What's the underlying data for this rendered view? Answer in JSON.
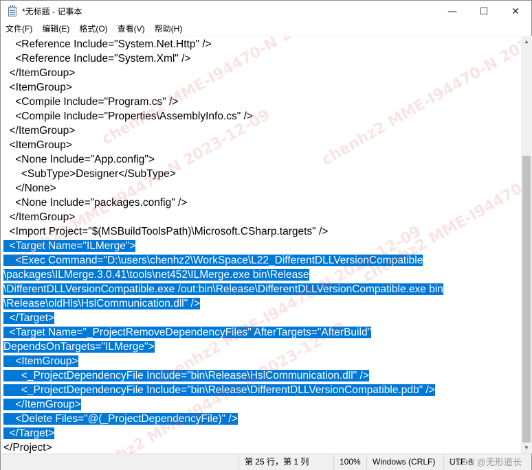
{
  "window": {
    "title": "*无标题 - 记事本",
    "controls": {
      "minimize": "—",
      "maximize": "☐",
      "close": "✕"
    },
    "icon": "notepad-icon"
  },
  "menu": [
    "文件(F)",
    "编辑(E)",
    "格式(O)",
    "查看(V)",
    "帮助(H)"
  ],
  "editor": {
    "lines": [
      {
        "text": "    <Reference Include=\"System.Net.Http\" />",
        "selected": false
      },
      {
        "text": "    <Reference Include=\"System.Xml\" />",
        "selected": false
      },
      {
        "text": "  </ItemGroup>",
        "selected": false
      },
      {
        "text": "  <ItemGroup>",
        "selected": false
      },
      {
        "text": "    <Compile Include=\"Program.cs\" />",
        "selected": false
      },
      {
        "text": "    <Compile Include=\"Properties\\AssemblyInfo.cs\" />",
        "selected": false
      },
      {
        "text": "  </ItemGroup>",
        "selected": false
      },
      {
        "text": "  <ItemGroup>",
        "selected": false
      },
      {
        "text": "    <None Include=\"App.config\">",
        "selected": false
      },
      {
        "text": "      <SubType>Designer</SubType>",
        "selected": false
      },
      {
        "text": "    </None>",
        "selected": false
      },
      {
        "text": "    <None Include=\"packages.config\" />",
        "selected": false
      },
      {
        "text": "  </ItemGroup>",
        "selected": false
      },
      {
        "text": "  <Import Project=\"$(MSBuildToolsPath)\\Microsoft.CSharp.targets\" />",
        "selected": false
      },
      {
        "text": "  <Target Name=\"ILMerge\">",
        "selected": true
      },
      {
        "text": "    <Exec Command=\"D:\\users\\chenhz2\\WorkSpace\\L22_DifferentDLLVersionCompatible",
        "selected": true
      },
      {
        "text": "\\packages\\ILMerge.3.0.41\\tools\\net452\\ILMerge.exe bin\\Release",
        "selected": true
      },
      {
        "text": "\\DifferentDLLVersionCompatible.exe /out:bin\\Release\\DifferentDLLVersionCompatible.exe bin",
        "selected": true
      },
      {
        "text": "\\Release\\oldHls\\HslCommunication.dll\" />",
        "selected": true
      },
      {
        "text": "  </Target>",
        "selected": true
      },
      {
        "text": "  <Target Name=\"_ProjectRemoveDependencyFiles\" AfterTargets=\"AfterBuild\"",
        "selected": true
      },
      {
        "text": "DependsOnTargets=\"ILMerge\">",
        "selected": true
      },
      {
        "text": "    <ItemGroup>",
        "selected": true
      },
      {
        "text": "      <_ProjectDependencyFile Include=\"bin\\Release\\HslCommunication.dll\" />",
        "selected": true
      },
      {
        "text": "      <_ProjectDependencyFile Include=\"bin\\Release\\DifferentDLLVersionCompatible.pdb\" />",
        "selected": true
      },
      {
        "text": "    </ItemGroup>",
        "selected": true
      },
      {
        "text": "    <Delete Files=\"@(_ProjectDependencyFile)\" />",
        "selected": true
      },
      {
        "text": "  </Target>",
        "selected": true
      },
      {
        "text": "</Project>",
        "selected": false
      }
    ]
  },
  "watermark": [
    "chenhz2 MME-I94470-N 2023-12-09",
    "chenhz2 MME-I94470-N 2023-12-09",
    "chenhz2 MME-I94470-N 2023-12-09",
    "chenhz2 MME-I94470-N 2023-12-09",
    "chenhz2 MME-I94470-N 2023-12-09",
    "chenhz2 MME-I94470-N 2023-12-09"
  ],
  "status": {
    "position": "第 25 行，第 1 列",
    "zoom": "100%",
    "line_ending": "Windows (CRLF)",
    "encoding": "UTF-8",
    "credit": "CSDN @无形道长"
  },
  "colors": {
    "selection": "#0078d7",
    "selection_text": "#ffffff"
  }
}
